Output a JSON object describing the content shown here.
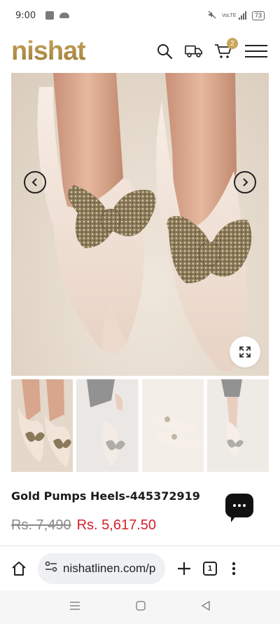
{
  "status_bar": {
    "time": "9:00",
    "network_label": "VoLTE",
    "battery": "73"
  },
  "header": {
    "logo": "nishat",
    "cart_count": "2"
  },
  "product": {
    "title": "Gold Pumps Heels-445372919",
    "old_price": "Rs. 7,490",
    "new_price": "Rs. 5,617.50"
  },
  "browser": {
    "url": "nishatlinen.com/p",
    "tab_count": "1"
  },
  "colors": {
    "brand_gold": "#b08d4a",
    "sale_red": "#d6202a"
  },
  "icons": [
    "search-icon",
    "delivery-truck-icon",
    "cart-icon",
    "menu-icon",
    "chevron-left-icon",
    "chevron-right-icon",
    "expand-icon",
    "chat-icon",
    "home-icon",
    "site-settings-icon",
    "plus-icon",
    "more-icon"
  ]
}
